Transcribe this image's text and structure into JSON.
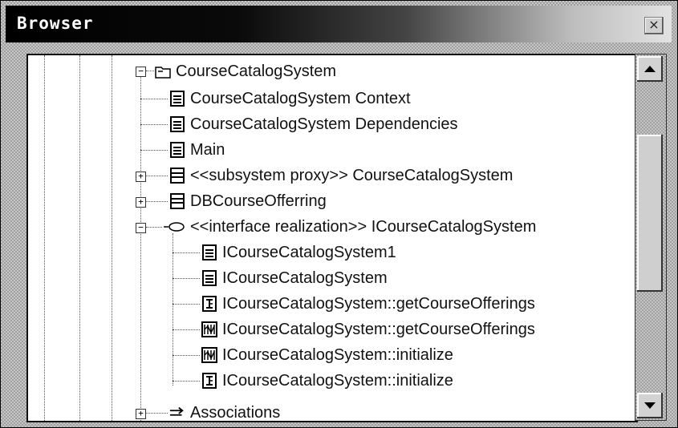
{
  "window": {
    "title": "Browser",
    "close_symbol": "×"
  },
  "tree": {
    "root": {
      "label": "CourseCatalogSystem",
      "icon": "package-icon",
      "expanded": true
    },
    "children": [
      {
        "label": "CourseCatalogSystem Context",
        "icon": "class-diagram-icon"
      },
      {
        "label": "CourseCatalogSystem Dependencies",
        "icon": "class-diagram-icon"
      },
      {
        "label": "Main",
        "icon": "class-diagram-icon"
      },
      {
        "label": "<<subsystem proxy>> CourseCatalogSystem",
        "icon": "class-icon",
        "expander": "+"
      },
      {
        "label": "DBCourseOfferring",
        "icon": "class-icon",
        "expander": "+"
      },
      {
        "label": "<<interface realization>> ICourseCatalogSystem",
        "icon": "realization-icon",
        "expander": "−"
      }
    ],
    "realization_children": [
      {
        "label": "ICourseCatalogSystem1",
        "icon": "class-diagram-icon"
      },
      {
        "label": "ICourseCatalogSystem",
        "icon": "class-diagram-icon"
      },
      {
        "label": "ICourseCatalogSystem::getCourseOfferings",
        "icon": "sequence-diagram-icon"
      },
      {
        "label": "ICourseCatalogSystem::getCourseOfferings",
        "icon": "collaboration-diagram-icon"
      },
      {
        "label": "ICourseCatalogSystem::initialize",
        "icon": "collaboration-diagram-icon"
      },
      {
        "label": "ICourseCatalogSystem::initialize",
        "icon": "sequence-diagram-icon"
      }
    ],
    "partial": {
      "label": "Associations",
      "icon": "association-icon",
      "expander": "+"
    },
    "root_expander": "−"
  }
}
